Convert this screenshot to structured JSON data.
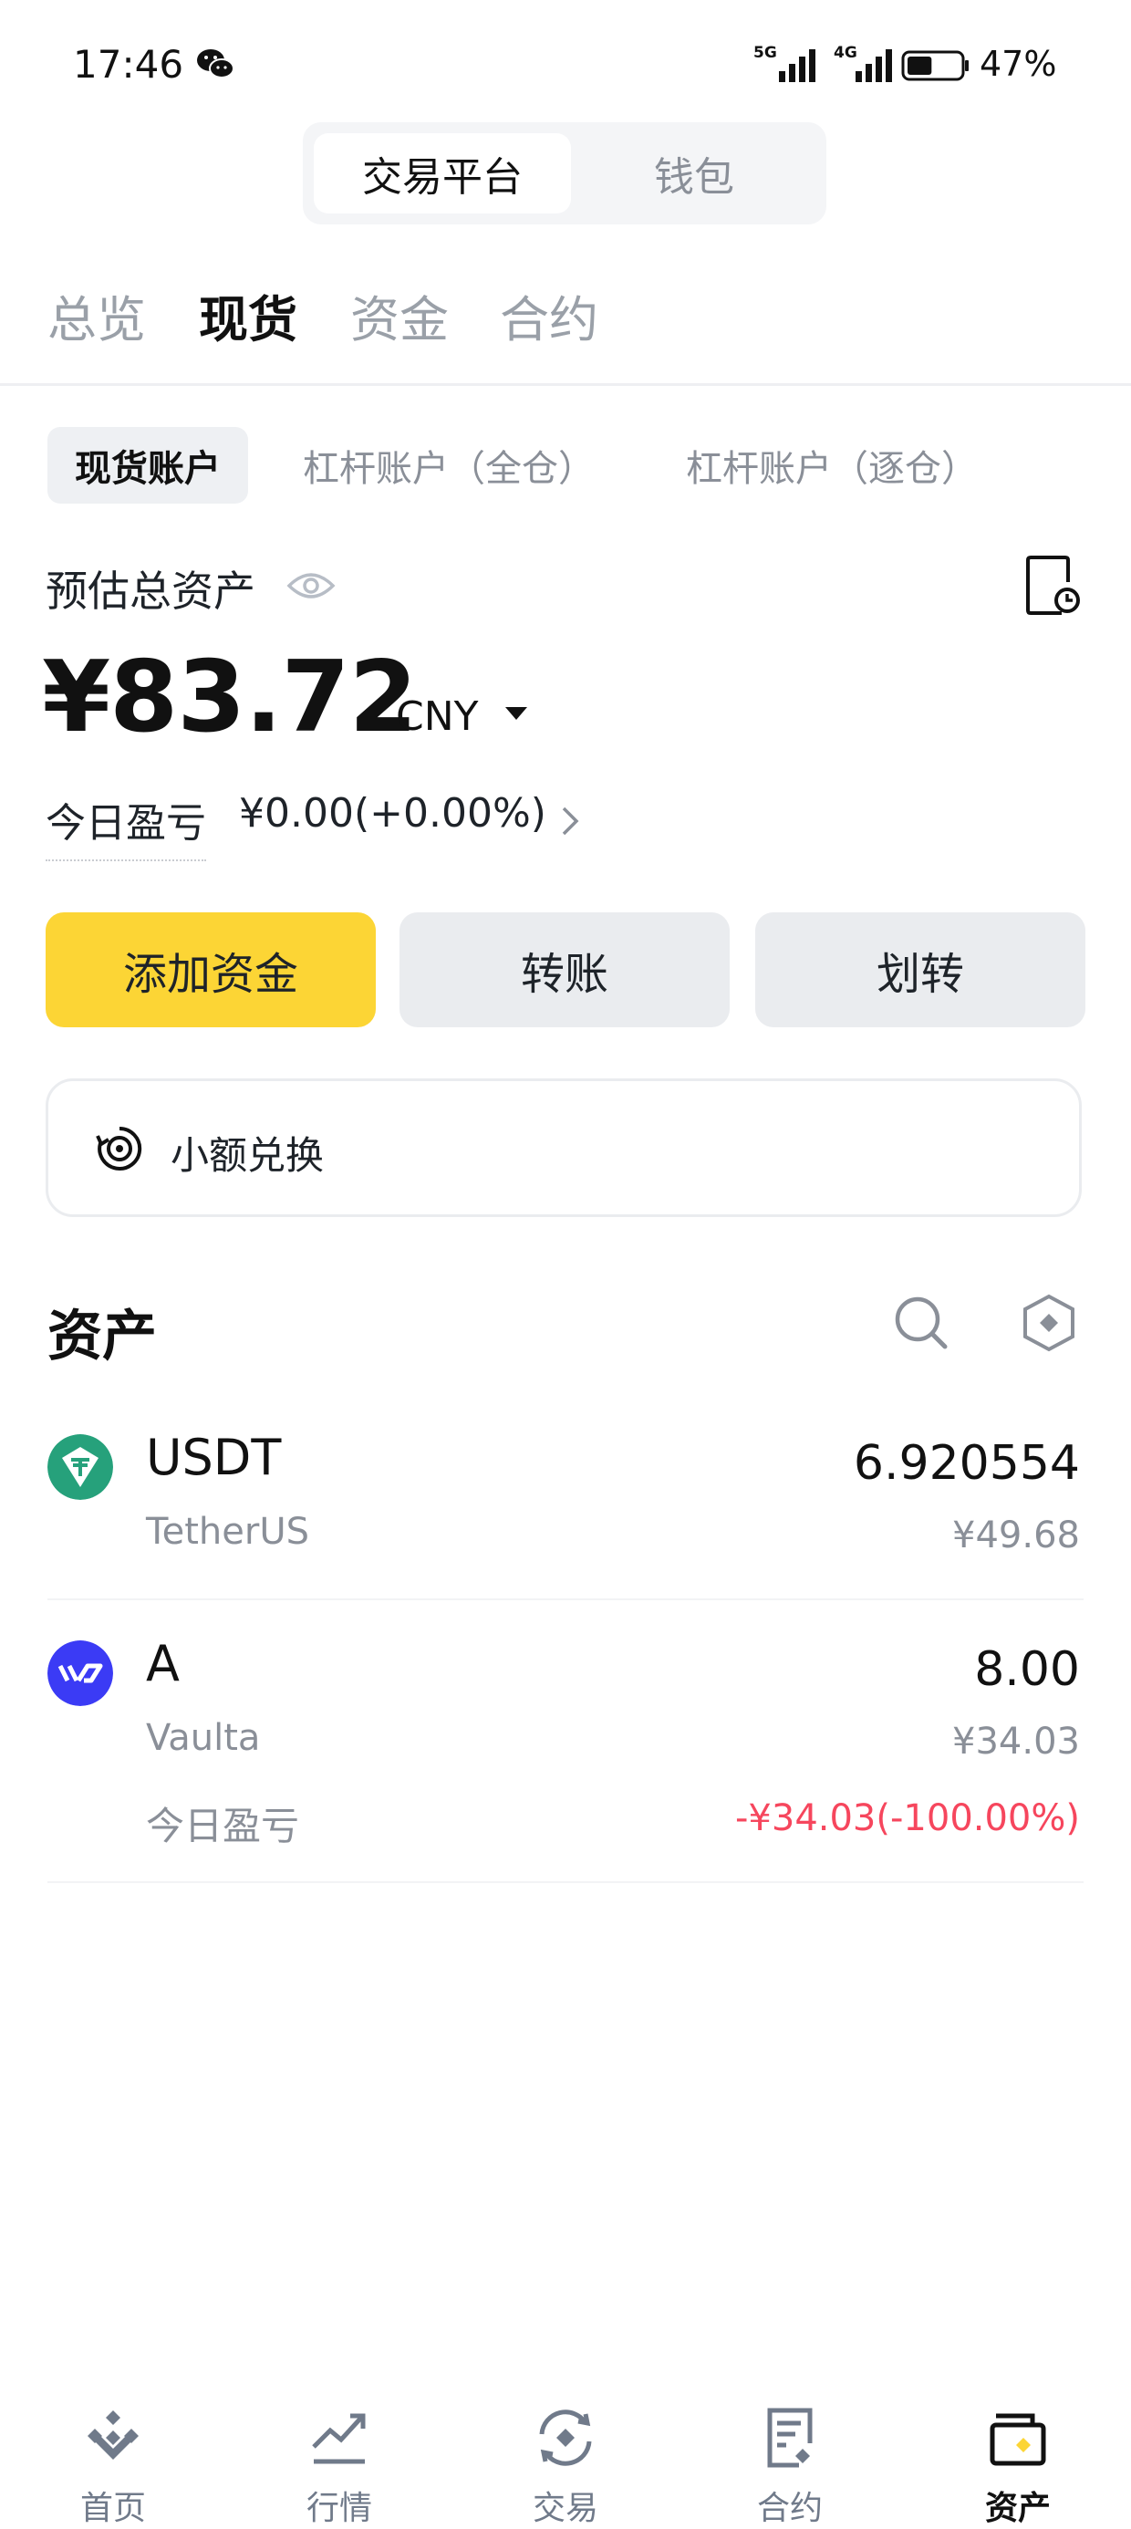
{
  "status_bar": {
    "time": "17:46",
    "signal_5g": "5G",
    "signal_4g": "4G",
    "battery": "47%",
    "battery_level": 0.47
  },
  "platform_switch": {
    "items": [
      "交易平台",
      "钱包"
    ],
    "active": 0
  },
  "main_tabs": [
    "总览",
    "现货",
    "资金",
    "合约"
  ],
  "sub_tabs": [
    "现货账户",
    "杠杆账户（全仓）",
    "杠杆账户（逐仓）"
  ],
  "summary": {
    "estimated_label": "预估总资产",
    "balance": "¥83.72",
    "currency": "CNY",
    "pnl_label": "今日盈亏",
    "pnl_value": "¥0.00(+0.00%)"
  },
  "actions": [
    "添加资金",
    "转账",
    "划转"
  ],
  "convert_label": "小额兑换",
  "assets_title": "资产",
  "assets": [
    {
      "symbol": "USDT",
      "name": "TetherUS",
      "amount": "6.920554",
      "fiat": "¥49.68",
      "color": "#26a17b"
    },
    {
      "symbol": "A",
      "name": "Vaulta",
      "amount": "8.00",
      "fiat": "¥34.03",
      "pnl_label": "今日盈亏",
      "pnl_value": "-¥34.03(-100.00%)",
      "color": "#3b3bf5"
    }
  ],
  "bottom_nav": [
    {
      "label": "首页",
      "icon": "home-icon"
    },
    {
      "label": "行情",
      "icon": "market-icon"
    },
    {
      "label": "交易",
      "icon": "trade-icon"
    },
    {
      "label": "合约",
      "icon": "futures-icon"
    },
    {
      "label": "资产",
      "icon": "wallet-icon"
    }
  ],
  "colors": {
    "accent": "#fcd535",
    "negative": "#f6465d"
  }
}
